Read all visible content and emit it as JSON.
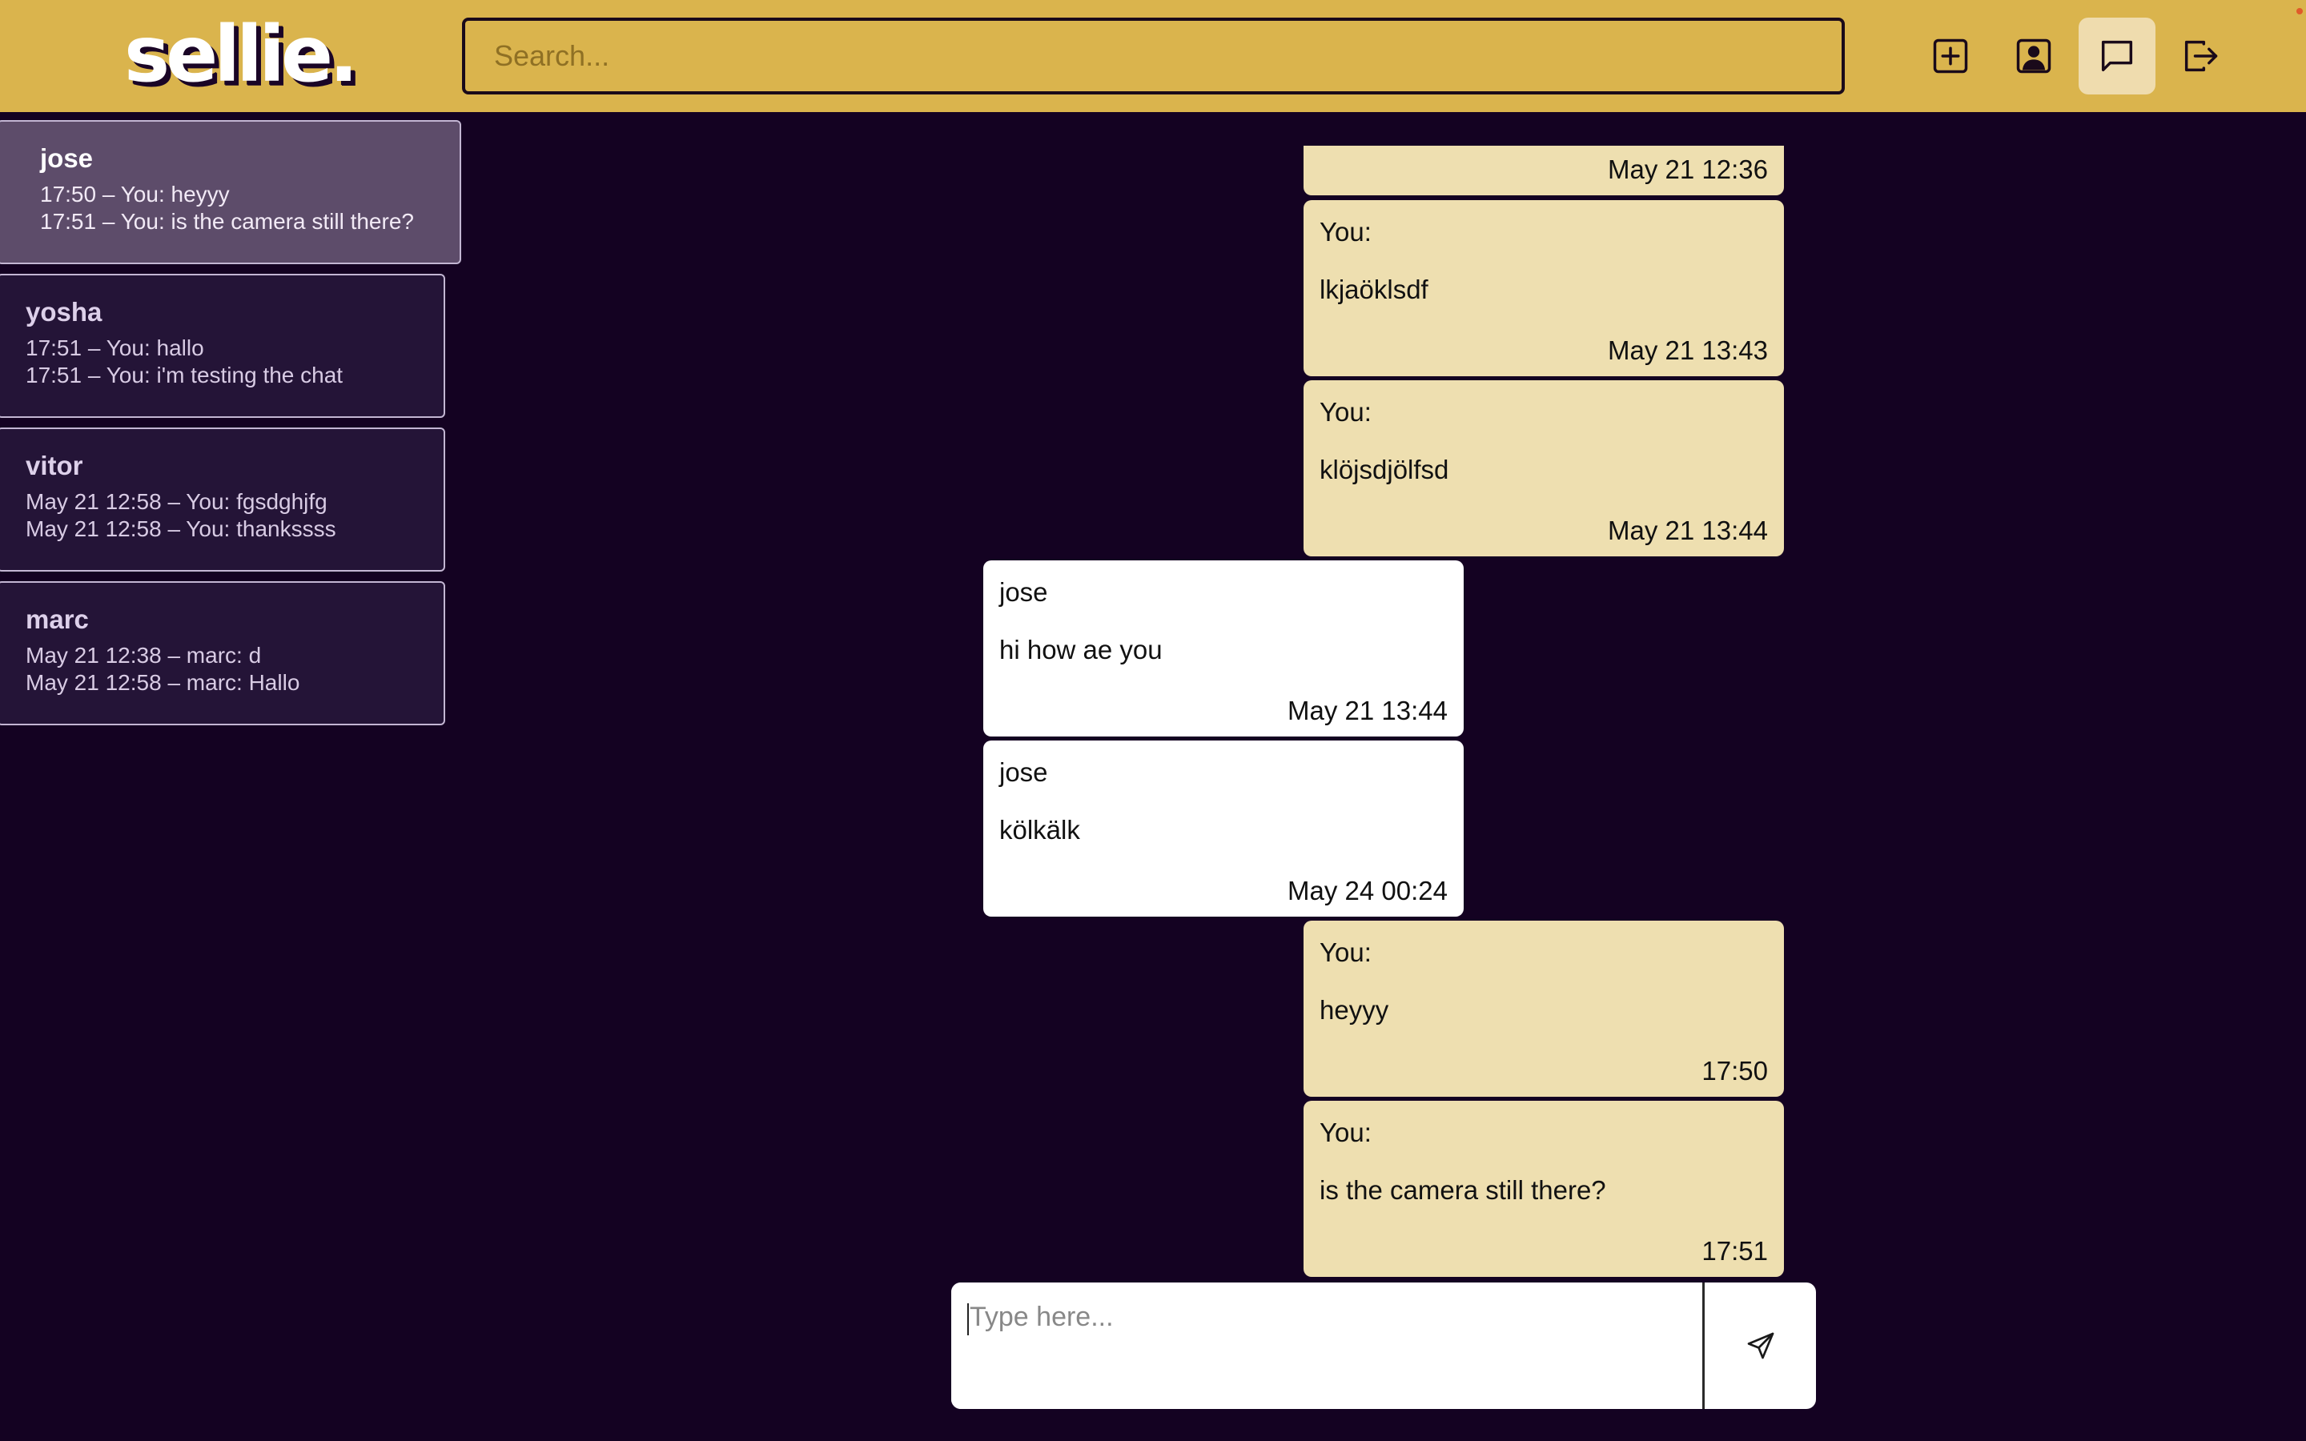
{
  "app": {
    "logo": "sellie."
  },
  "header": {
    "search_placeholder": "Search...",
    "icons": [
      "plus-square-icon",
      "user-profile-icon",
      "chat-bubble-icon",
      "logout-icon"
    ],
    "active_icon": "chat-bubble-icon"
  },
  "colors": {
    "header_bg": "#dab44d",
    "page_bg": "#140222",
    "own_bubble": "#eedfb0",
    "other_bubble": "#ffffff",
    "sidebar_item": "#241437",
    "sidebar_item_active": "#5d4c6a"
  },
  "sidebar": {
    "conversations": [
      {
        "name": "jose",
        "lines": [
          "17:50 – You: heyyy",
          "17:51 – You: is the camera still there?"
        ],
        "active": true
      },
      {
        "name": "yosha",
        "lines": [
          "17:51 – You: hallo",
          "17:51 – You: i'm testing the chat"
        ],
        "active": false
      },
      {
        "name": "vitor",
        "lines": [
          "May 21 12:58 – You: fgsdghjfg",
          "May 21 12:58 – You: thankssss"
        ],
        "active": false
      },
      {
        "name": "marc",
        "lines": [
          "May 21 12:38 – marc: d",
          "May 21 12:58 – marc: Hallo"
        ],
        "active": false
      }
    ]
  },
  "chat": {
    "partial_message": {
      "time": "May 21 12:36"
    },
    "messages": [
      {
        "sender": "You:",
        "text": "lkjaöklsdf",
        "time": "May 21 13:43",
        "mine": true
      },
      {
        "sender": "You:",
        "text": "klöjsdjölfsd",
        "time": "May 21 13:44",
        "mine": true
      },
      {
        "sender": "jose",
        "text": "hi how ae you",
        "time": "May 21 13:44",
        "mine": false
      },
      {
        "sender": "jose",
        "text": "kölkälk",
        "time": "May 24 00:24",
        "mine": false
      },
      {
        "sender": "You:",
        "text": "heyyy",
        "time": "17:50",
        "mine": true
      },
      {
        "sender": "You:",
        "text": "is the camera still there?",
        "time": "17:51",
        "mine": true
      }
    ]
  },
  "composer": {
    "placeholder": "Type here...",
    "send_icon": "send-icon"
  }
}
